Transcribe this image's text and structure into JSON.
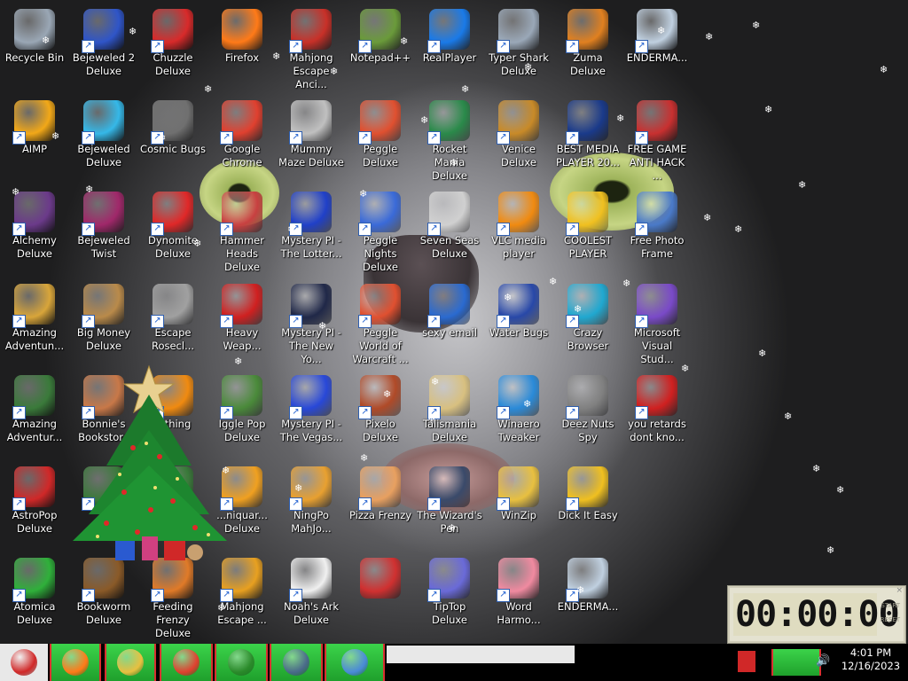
{
  "desktop": {
    "icons": [
      {
        "label": "Recycle Bin",
        "icon": "recycle-bin-icon",
        "color": "#9aa7b5",
        "shortcut": false
      },
      {
        "label": "AIMP",
        "icon": "aimp-icon",
        "color": "#f2a818",
        "shortcut": true
      },
      {
        "label": "Alchemy Deluxe",
        "icon": "alchemy-wizard-icon",
        "color": "#6b3a8a",
        "shortcut": true
      },
      {
        "label": "Amazing Adventun...",
        "icon": "amazing-adventures-icon",
        "color": "#d8a53a",
        "shortcut": true
      },
      {
        "label": "Amazing Adventur...",
        "icon": "amazing-adventures-globe-icon",
        "color": "#3a7a3a",
        "shortcut": true
      },
      {
        "label": "AstroPop Deluxe",
        "icon": "astropop-icon",
        "color": "#d02828",
        "shortcut": true
      },
      {
        "label": "Atomica Deluxe",
        "icon": "atomica-icon",
        "color": "#2fb03a",
        "shortcut": true
      },
      {
        "label": "Bejeweled 2 Deluxe",
        "icon": "bejeweled2-icon",
        "color": "#2f55c8",
        "shortcut": true
      },
      {
        "label": "Bejeweled Deluxe",
        "icon": "bejeweled-diamond-icon",
        "color": "#35b8e8",
        "shortcut": true
      },
      {
        "label": "Bejeweled Twist",
        "icon": "bejeweled-twist-icon",
        "color": "#a0286a",
        "shortcut": true
      },
      {
        "label": "Big Money Deluxe",
        "icon": "money-bag-icon",
        "color": "#b98a4a",
        "shortcut": true
      },
      {
        "label": "Bonnie's Bookstore",
        "icon": "bonnie-icon",
        "color": "#c87848",
        "shortcut": true
      },
      {
        "label": "",
        "icon": "hidden-icon",
        "color": "#3a7a3a",
        "shortcut": true
      },
      {
        "label": "Bookworm Deluxe",
        "icon": "bookworm-icon",
        "color": "#8a5a28",
        "shortcut": true
      },
      {
        "label": "Chuzzle Deluxe",
        "icon": "chuzzle-icon",
        "color": "#d82a2a",
        "shortcut": true
      },
      {
        "label": "Cosmic Bugs",
        "icon": "cosmic-bugs-gear-icon",
        "color": "#707070",
        "shortcut": true
      },
      {
        "label": "Dynomite Deluxe",
        "icon": "dynomite-egg-icon",
        "color": "#e02828",
        "shortcut": true
      },
      {
        "label": "Escape Rosecl...",
        "icon": "escape-moon-icon",
        "color": "#a0a0a0",
        "shortcut": true
      },
      {
        "label": "...thing",
        "icon": "ring-icon",
        "color": "#f08a10",
        "shortcut": true
      },
      {
        "label": "",
        "icon": "hidden-icon-2",
        "color": "#3a7a3a",
        "shortcut": true
      },
      {
        "label": "Feeding Frenzy Deluxe",
        "icon": "feeding-frenzy-icon",
        "color": "#e07a28",
        "shortcut": true
      },
      {
        "label": "Firefox",
        "icon": "firefox-icon",
        "color": "#ff7a18",
        "shortcut": false
      },
      {
        "label": "Google Chrome",
        "icon": "chrome-icon",
        "color": "#e0402f",
        "shortcut": true
      },
      {
        "label": "Hammer Heads Deluxe",
        "icon": "gnome-icon",
        "color": "#c84040",
        "shortcut": true
      },
      {
        "label": "Heavy Weap...",
        "icon": "radiation-icon",
        "color": "#d02020",
        "shortcut": true
      },
      {
        "label": "Iggle Pop Deluxe",
        "icon": "iggle-pop-icon",
        "color": "#4a8a3a",
        "shortcut": true
      },
      {
        "label": "...niquar... Deluxe",
        "icon": "fish-icon",
        "color": "#f0a020",
        "shortcut": true
      },
      {
        "label": "Mahjong Escape ...",
        "icon": "mahjong-tile-icon",
        "color": "#e8a020",
        "shortcut": true
      },
      {
        "label": "Mahjong Escape Anci...",
        "icon": "mahjong-gate-icon",
        "color": "#c83028",
        "shortcut": true
      },
      {
        "label": "Mummy Maze Deluxe",
        "icon": "mummy-icon",
        "color": "#c0c0c0",
        "shortcut": true
      },
      {
        "label": "Mystery PI - The Lotter...",
        "icon": "mpi-icon",
        "color": "#2040c8",
        "shortcut": true
      },
      {
        "label": "Mystery PI - The New Yo...",
        "icon": "mpi-dark-icon",
        "color": "#202848",
        "shortcut": true
      },
      {
        "label": "Mystery PI - The Vegas...",
        "icon": "mpi-vegas-icon",
        "color": "#2848d8",
        "shortcut": true
      },
      {
        "label": "NingPo MahJo...",
        "icon": "ningpo-icon",
        "color": "#e8a030",
        "shortcut": true
      },
      {
        "label": "Noah's Ark Deluxe",
        "icon": "dove-icon",
        "color": "#f0f0f0",
        "shortcut": true
      },
      {
        "label": "Notepad++",
        "icon": "notepadpp-icon",
        "color": "#6a9a3a",
        "shortcut": true
      },
      {
        "label": "Peggle Deluxe",
        "icon": "peggle-icon",
        "color": "#e05030",
        "shortcut": true
      },
      {
        "label": "Peggle Nights Deluxe",
        "icon": "peggle-nights-icon",
        "color": "#3a6ad8",
        "shortcut": true
      },
      {
        "label": "Peggle World of Warcraft ...",
        "icon": "peggle-wow-icon",
        "color": "#e05030",
        "shortcut": true
      },
      {
        "label": "Pixelo Deluxe",
        "icon": "pixelo-icon",
        "color": "#b04a28",
        "shortcut": true
      },
      {
        "label": "Pizza Frenzy",
        "icon": "pizza-icon",
        "color": "#e8a060",
        "shortcut": true
      },
      {
        "label": "",
        "icon": "red-cursor-icon",
        "color": "#d03030",
        "shortcut": false
      },
      {
        "label": "RealPlayer",
        "icon": "realplayer-icon",
        "color": "#1a7ae8",
        "shortcut": true
      },
      {
        "label": "Rocket Mania Deluxe",
        "icon": "rocket-mania-icon",
        "color": "#2a8a4a",
        "shortcut": true
      },
      {
        "label": "Seven Seas Deluxe",
        "icon": "pirate-skull-icon",
        "color": "#d0d0d0",
        "shortcut": true
      },
      {
        "label": "sexy email",
        "icon": "thunderbird-icon",
        "color": "#2a6ad0",
        "shortcut": true
      },
      {
        "label": "Talismania Deluxe",
        "icon": "talismania-icon",
        "color": "#d8c080",
        "shortcut": true
      },
      {
        "label": "The Wizard's Pen",
        "icon": "wizard-house-icon",
        "color": "#3a4a6a",
        "shortcut": true
      },
      {
        "label": "TipTop Deluxe",
        "icon": "cocktail-icon",
        "color": "#6a6ad8",
        "shortcut": true
      },
      {
        "label": "Typer Shark Deluxe",
        "icon": "shark-icon",
        "color": "#9aa8b8",
        "shortcut": true
      },
      {
        "label": "Venice Deluxe",
        "icon": "gondola-icon",
        "color": "#c88a28",
        "shortcut": true
      },
      {
        "label": "VLC media player",
        "icon": "vlc-cone-icon",
        "color": "#f08a10",
        "shortcut": true
      },
      {
        "label": "Water Bugs",
        "icon": "water-bugs-icon",
        "color": "#2848a8",
        "shortcut": true
      },
      {
        "label": "Winaero Tweaker",
        "icon": "winaero-icon",
        "color": "#2a8ad8",
        "shortcut": true
      },
      {
        "label": "WinZip",
        "icon": "winzip-cabinet-icon",
        "color": "#e8c040",
        "shortcut": true
      },
      {
        "label": "Word Harmo...",
        "icon": "flower-icon",
        "color": "#f08aa0",
        "shortcut": true
      },
      {
        "label": "Zuma Deluxe",
        "icon": "zuma-icon",
        "color": "#e08020",
        "shortcut": true
      },
      {
        "label": "BEST MEDIA PLAYER 20...",
        "icon": "xm-player-icon",
        "color": "#1a3a8a",
        "shortcut": true
      },
      {
        "label": "COOLEST PLAYER",
        "icon": "smiley-icon",
        "color": "#f0c020",
        "shortcut": true
      },
      {
        "label": "Crazy Browser",
        "icon": "crazy-browser-icon",
        "color": "#20a8d0",
        "shortcut": true
      },
      {
        "label": "Deez Nuts Spy",
        "icon": "stacked-windows-icon",
        "color": "#808080",
        "shortcut": true
      },
      {
        "label": "Dick It Easy",
        "icon": "de-logo-icon",
        "color": "#f0c020",
        "shortcut": true
      },
      {
        "label": "ENDERMA...",
        "icon": "window-app-icon",
        "color": "#c0d0e0",
        "shortcut": true
      },
      {
        "label": "ENDERMA...",
        "icon": "window-app-icon",
        "color": "#c0d0e0",
        "shortcut": true
      },
      {
        "label": "FREE GAME ANTI HACK ...",
        "icon": "anti-hack-icon",
        "color": "#c83030",
        "shortcut": true
      },
      {
        "label": "Free Photo Frame",
        "icon": "photo-frame-icon",
        "color": "#4a7ac8",
        "shortcut": true
      },
      {
        "label": "Microsoft Visual Stud...",
        "icon": "visual-studio-icon",
        "color": "#7a4ac8",
        "shortcut": true
      },
      {
        "label": "you retards dont kno...",
        "icon": "red-dragon-icon",
        "color": "#d02020",
        "shortcut": true
      }
    ]
  },
  "stopwatch": {
    "display": "00:00:00",
    "start_label": "START",
    "reset_label": "RESET",
    "close_label": "×"
  },
  "taskbar": {
    "items": [
      {
        "icon": "santa-start-icon",
        "color": "#d02828"
      },
      {
        "icon": "firefox-taskbar-icon",
        "color": "#ff7a18"
      },
      {
        "icon": "file-explorer-icon",
        "color": "#e8c040"
      },
      {
        "icon": "chrome-taskbar-icon",
        "color": "#e0402f"
      },
      {
        "icon": "christmas-tree-taskbar-icon",
        "color": "#2a8a2a"
      },
      {
        "icon": "monitor-taskbar-icon",
        "color": "#4a6a8a"
      },
      {
        "icon": "computer-taskbar-icon",
        "color": "#4a8ad8"
      }
    ],
    "time": "4:01 PM",
    "date": "12/16/2023"
  }
}
